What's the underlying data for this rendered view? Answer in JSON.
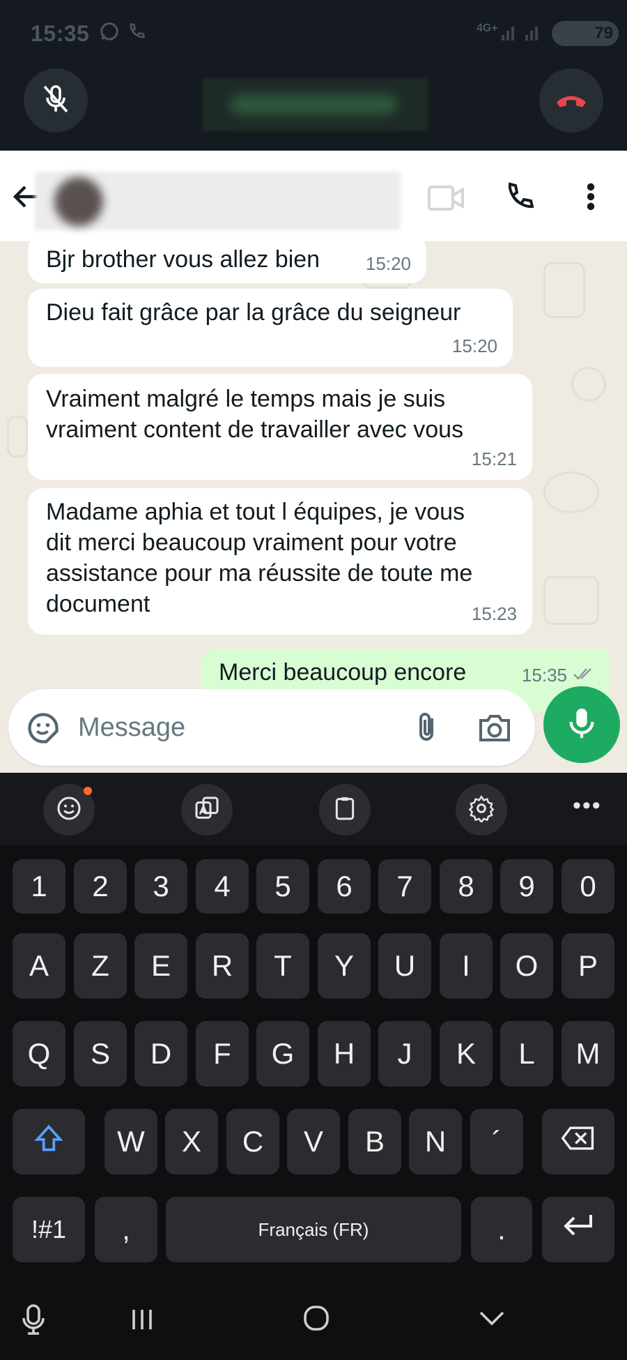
{
  "status_bar": {
    "time": "15:35",
    "network": "4G+",
    "battery": "79"
  },
  "call_banner": {
    "mute_icon": "mic-off-icon",
    "end_icon": "end-call-icon"
  },
  "chat_header": {
    "back_icon": "back-arrow-icon",
    "video_icon": "video-call-icon",
    "call_icon": "phone-icon",
    "menu_icon": "more-vertical-icon"
  },
  "messages": [
    {
      "direction": "in",
      "text": "Bjr brother vous allez bien",
      "time": "15:20"
    },
    {
      "direction": "in",
      "text": "Dieu fait grâce par la grâce du seigneur",
      "time": "15:20"
    },
    {
      "direction": "in",
      "lines": [
        "Vraiment malgré le temps mais je suis",
        "vraiment content de travailler avec vous"
      ],
      "time": "15:21"
    },
    {
      "direction": "in",
      "lines": [
        "Madame aphia et tout l équipes, je vous",
        "dit merci beaucoup vraiment pour votre",
        "assistance pour ma réussite de toute me",
        "document"
      ],
      "time": "15:23"
    },
    {
      "direction": "out",
      "text": "Merci beaucoup encore",
      "time": "15:35"
    }
  ],
  "composer": {
    "placeholder": "Message"
  },
  "keyboard": {
    "row_numbers": [
      "1",
      "2",
      "3",
      "4",
      "5",
      "6",
      "7",
      "8",
      "9",
      "0"
    ],
    "row_1": [
      "A",
      "Z",
      "E",
      "R",
      "T",
      "Y",
      "U",
      "I",
      "O",
      "P"
    ],
    "row_2": [
      "Q",
      "S",
      "D",
      "F",
      "G",
      "H",
      "J",
      "K",
      "L",
      "M"
    ],
    "row_3": [
      "W",
      "X",
      "C",
      "V",
      "B",
      "N",
      "´"
    ],
    "symbols_label": "!#1",
    "comma_label": ",",
    "space_label": "Français (FR)",
    "period_label": "."
  },
  "colors": {
    "accent_green": "#1daa61",
    "end_call_red": "#e5484d",
    "outgoing_bubble": "#d9fdd3",
    "shift_blue": "#5aa0ff"
  }
}
